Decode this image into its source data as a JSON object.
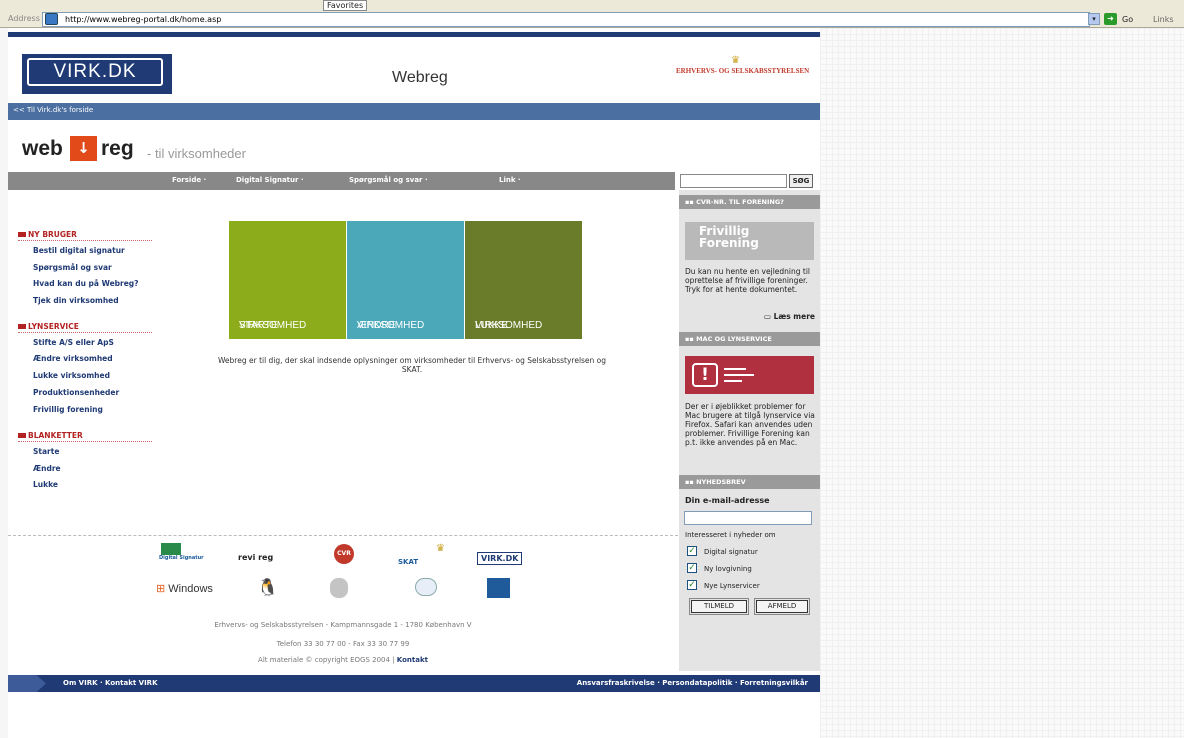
{
  "browser": {
    "address_label": "Address",
    "url": "http://www.webreg-portal.dk/home.asp",
    "favorites": "Favorites",
    "go": "Go",
    "links": "Links"
  },
  "header": {
    "virk_logo": "VIRK.DK",
    "title": "Webreg",
    "ebst_logo": "ERHVERVS- OG SELSKABSSTYRELSEN",
    "back_link": "<< Til Virk.dk's forside"
  },
  "brand": {
    "web": "web",
    "reg": "reg",
    "tagline": "- til virksomheder"
  },
  "nav": {
    "items": [
      "Forside ·",
      "Digital Signatur ·",
      "Spørgsmål og svar ·",
      "Link ·"
    ],
    "search_button": "SØG"
  },
  "left": {
    "sections": [
      {
        "title": "NY BRUGER",
        "links": [
          "Bestil digital signatur",
          "Spørgsmål og svar",
          "Hvad kan du på Webreg?",
          "Tjek din virksomhed"
        ]
      },
      {
        "title": "LYNSERVICE",
        "links": [
          "Stifte A/S eller ApS",
          "Ændre virksomhed",
          "Lukke virksomhed",
          "Produktionsenheder",
          "Frivillig forening"
        ]
      },
      {
        "title": "BLANKETTER",
        "links": [
          "Starte",
          "Ændre",
          "Lukke"
        ]
      }
    ]
  },
  "tiles": [
    {
      "line1": "STARTE",
      "line2": "VIRKSOMHED",
      "color": "#8cac1c"
    },
    {
      "line1": "ÆNDRE",
      "line2": "VIRKSOMHED",
      "color": "#4aa8b8"
    },
    {
      "line1": "LUKKE",
      "line2": "VIRKSOMHED",
      "color": "#6a7c2a"
    }
  ],
  "intro": "Webreg er til dig, der skal indsende oplysninger om virksomheder til Erhvervs- og Selskabsstyrelsen og SKAT.",
  "right": {
    "cvr_heading": "CVR-NR. TIL FORENING?",
    "frivillig_img_line1": "Frivillig",
    "frivillig_img_line2": "Forening",
    "cvr_text": "Du kan nu hente en vejledning til oprettelse af frivillige foreninger. Tryk for at hente dokumentet.",
    "read_more": "Læs mere",
    "mac_heading": "MAC OG LYNSERVICE",
    "mac_text": "Der er i øjeblikket problemer for Mac brugere at tilgå lynservice via Firefox. Safari kan anvendes uden problemer. Frivillige Forening kan p.t. ikke anvendes på en Mac.",
    "news_heading": "NYHEDSBREV",
    "email_label": "Din e-mail-adresse",
    "interest_label": "Interesseret i nyheder om",
    "checkboxes": [
      "Digital signatur",
      "Ny lovgivning",
      "Nye Lynservicer"
    ],
    "subscribe": "TILMELD",
    "unsubscribe": "AFMELD"
  },
  "partners": {
    "digital_signatur": "Digital Signatur",
    "revireg": "revi reg",
    "cvr": "CVR",
    "skat": "SKAT",
    "virk": "VIRK.DK",
    "windows": "Windows"
  },
  "footer": {
    "address": "Erhvervs- og Selskabsstyrelsen - Kampmannsgade 1 - 1780 København V",
    "phone": "Telefon 33 30 77 00 - Fax 33 30 77 99",
    "copyright": "Alt materiale © copyright EOGS 2004 |",
    "contact": "Kontakt",
    "left_links": "Om VIRK · Kontakt VIRK",
    "right_links": "Ansvarsfraskrivelse · Persondatapolitik · Forretningsvilkår"
  }
}
